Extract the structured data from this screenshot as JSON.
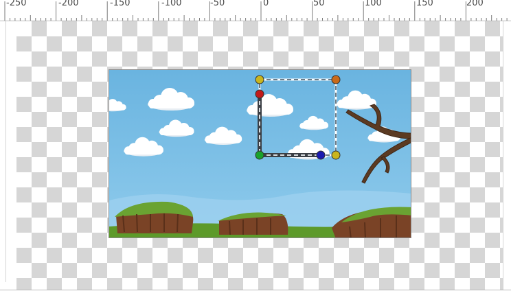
{
  "ruler": {
    "labels": [
      "-250",
      "-200",
      "-150",
      "-100",
      "-50",
      "0",
      "50",
      "100",
      "150",
      "200"
    ]
  },
  "scene": {
    "sky_color": "#6db6e2",
    "ground_color": "#5d9a2a",
    "dirt_color": "#7a4326"
  },
  "selection": {
    "handle_colors": {
      "top_left": "#c9b51e",
      "top_right": "#c96a1a",
      "left_mid": "#c21a1a",
      "bottom_left": "#1aa12c",
      "bottom_mid": "#1a1ab0",
      "bottom_right": "#c9b51e"
    }
  }
}
